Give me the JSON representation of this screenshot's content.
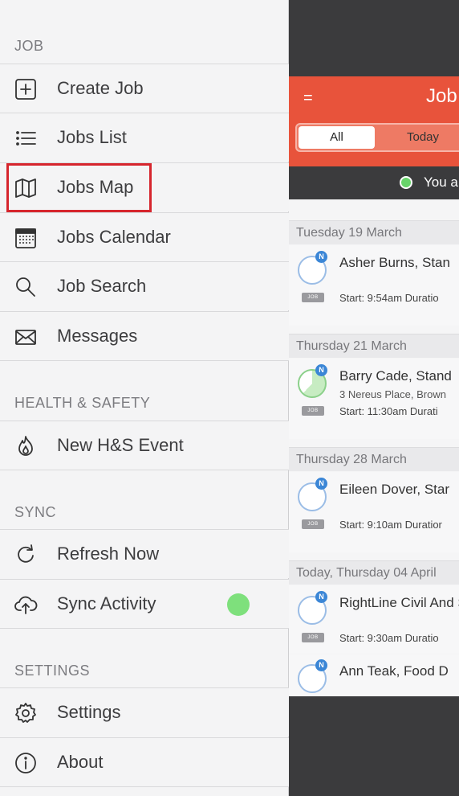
{
  "menu": {
    "sections": {
      "job": "JOB",
      "health": "HEALTH & SAFETY",
      "sync": "SYNC",
      "settings": "SETTINGS"
    },
    "items": {
      "create_job": "Create Job",
      "jobs_list": "Jobs List",
      "jobs_map": "Jobs Map",
      "jobs_calendar": "Jobs Calendar",
      "job_search": "Job Search",
      "messages": "Messages",
      "new_hs_event": "New H&S Event",
      "refresh_now": "Refresh Now",
      "sync_activity": "Sync Activity",
      "settings": "Settings",
      "about": "About"
    },
    "sync_status_color": "#7ee07c",
    "highlight_color": "#d6252d"
  },
  "app": {
    "title": "Job",
    "menu_button": "=",
    "tabs": {
      "all": "All",
      "today": "Today"
    },
    "status_text": "You a",
    "accent_color": "#e8533b",
    "days": [
      {
        "header": "Tuesday 19 March",
        "jobs": [
          {
            "name": "Asher Burns, Stan",
            "start": "Start: 9:54am  Duratio",
            "badge": "N",
            "tag": "JOB"
          }
        ]
      },
      {
        "header": "Thursday 21 March",
        "jobs": [
          {
            "name": "Barry Cade, Stand",
            "address": "3 Nereus Place, Brown",
            "start": "Start: 11:30am  Durati",
            "badge": "N",
            "tag": "JOB"
          }
        ]
      },
      {
        "header": "Thursday 28 March",
        "jobs": [
          {
            "name": "Eileen Dover, Star",
            "start": "Start: 9:10am  Duratior",
            "badge": "N",
            "tag": "JOB"
          }
        ]
      },
      {
        "header": "Today, Thursday 04 April",
        "jobs": [
          {
            "name": "RightLine Civil And S",
            "start": "Start: 9:30am  Duratio",
            "badge": "N",
            "tag": "JOB"
          },
          {
            "name": "Ann Teak, Food D",
            "badge": "N"
          }
        ]
      }
    ]
  }
}
